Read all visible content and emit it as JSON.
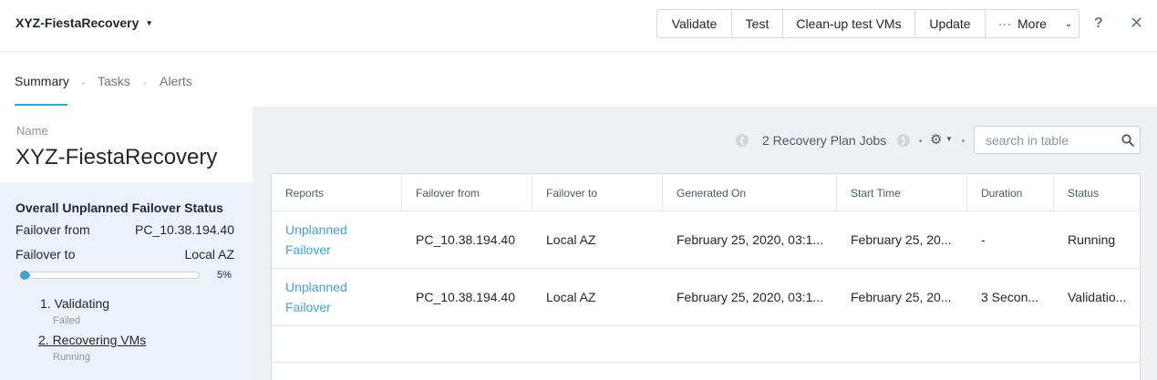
{
  "header": {
    "plan_name": "XYZ-FiestaRecovery",
    "buttons": {
      "validate": "Validate",
      "test": "Test",
      "cleanup": "Clean-up test VMs",
      "update": "Update",
      "more": "More"
    },
    "help": "?",
    "close": "✕"
  },
  "tabs": [
    {
      "label": "Summary",
      "active": true
    },
    {
      "label": "Tasks",
      "active": false
    },
    {
      "label": "Alerts",
      "active": false
    }
  ],
  "summary": {
    "name_label": "Name",
    "name_value": "XYZ-FiestaRecovery",
    "status": {
      "title": "Overall Unplanned Failover Status",
      "failover_from_label": "Failover from",
      "failover_from_value": "PC_10.38.194.40",
      "failover_to_label": "Failover to",
      "failover_to_value": "Local AZ",
      "progress_percent": 5,
      "progress_text": "5%",
      "steps": [
        {
          "label": "1. Validating",
          "status": "Failed"
        },
        {
          "label": "2. Recovering VMs",
          "status": "Running"
        }
      ]
    }
  },
  "toolbar": {
    "jobs_count": "2 Recovery Plan Jobs",
    "search_placeholder": "search in table"
  },
  "table": {
    "columns": [
      "Reports",
      "Failover from",
      "Failover to",
      "Generated On",
      "Start Time",
      "Duration",
      "Status"
    ],
    "rows": [
      {
        "report": "Unplanned Failover",
        "failover_from": "PC_10.38.194.40",
        "failover_to": "Local AZ",
        "generated_on": "February 25, 2020, 03:1...",
        "start_time": "February 25, 20...",
        "duration": "-",
        "status": "Running"
      },
      {
        "report": "Unplanned Failover",
        "failover_from": "PC_10.38.194.40",
        "failover_to": "Local AZ",
        "generated_on": "February 25, 2020, 03:1...",
        "start_time": "February 25, 20...",
        "duration": "3 Secon...",
        "status": "Validatio..."
      }
    ]
  },
  "colors": {
    "accent": "#3ea2d6",
    "panel_bg": "#ebf3f9",
    "content_bg": "#eef1f4"
  }
}
